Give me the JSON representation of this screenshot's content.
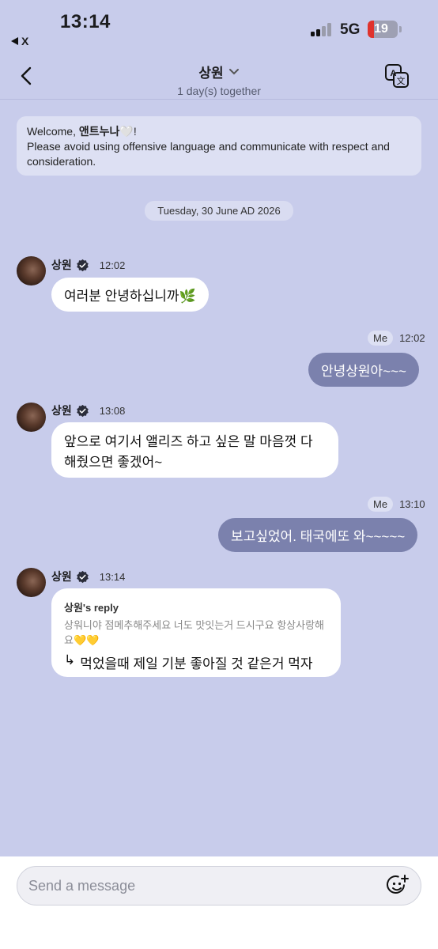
{
  "status_bar": {
    "time": "13:14",
    "back_app": "X",
    "network": "5G",
    "battery": "19"
  },
  "header": {
    "title": "상원",
    "subtitle": "1 day(s) together"
  },
  "notice": {
    "welcome_prefix": "Welcome, ",
    "username": "앤트누나",
    "welcome_suffix": "🤍!",
    "body": "Please avoid using offensive language and communicate with respect and consideration."
  },
  "date_separator": "Tuesday, 30 June AD 2026",
  "messages": [
    {
      "sender": "상원",
      "time": "12:02",
      "text": "여러분 안녕하십니까🌿"
    },
    {
      "sender": "Me",
      "time": "12:02",
      "text": "안녕상원아~~~"
    },
    {
      "sender": "상원",
      "time": "13:08",
      "text": "앞으로 여기서 앨리즈 하고 싶은 말 마음껏 다 해줬으면 좋겠어~"
    },
    {
      "sender": "Me",
      "time": "13:10",
      "text": "보고싶었어. 태국에또 와~~~~~"
    },
    {
      "sender": "상원",
      "time": "13:14",
      "reply_title": "상원's reply",
      "reply_quote": "상워니야 점메추해주세요 너도 맛잇는거 드시구요 항상사랑해요💛💛",
      "reply_arrow": "↳",
      "text": "먹었을때 제일 기분 좋아질 것 같은거 먹자"
    }
  ],
  "composer": {
    "placeholder": "Send a message"
  },
  "colors": {
    "background": "#c8cceb",
    "outgoing_bubble": "#7b81ad",
    "incoming_bubble": "#ffffff"
  },
  "icons": [
    "back-arrow-icon",
    "chevron-down-icon",
    "translate-icon",
    "verified-badge-icon",
    "emoji-add-icon"
  ]
}
